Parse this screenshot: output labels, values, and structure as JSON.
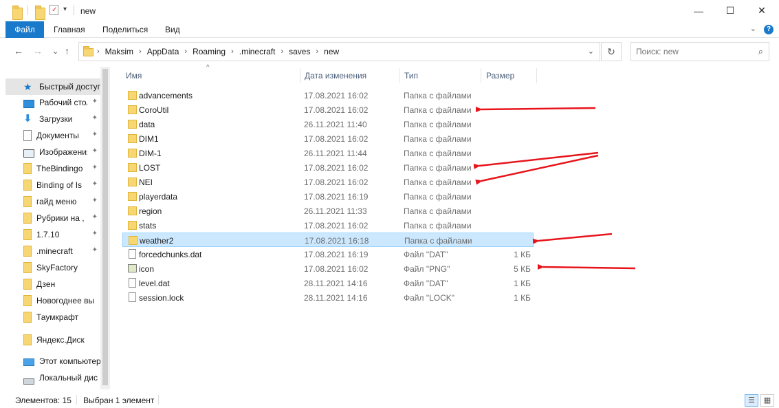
{
  "window": {
    "title": "new",
    "minimize_glyph": "—",
    "maximize_glyph": "☐",
    "close_glyph": "✕"
  },
  "ribbon": {
    "tabs": [
      "Файл",
      "Главная",
      "Поделиться",
      "Вид"
    ],
    "expand_glyph": "⌄",
    "help_glyph": "?"
  },
  "nav": {
    "back_glyph": "←",
    "forward_glyph": "→",
    "recent_glyph": "⌄",
    "up_glyph": "↑",
    "breadcrumbs": [
      "Maksim",
      "AppData",
      "Roaming",
      ".minecraft",
      "saves",
      "new"
    ],
    "crumb_sep": "›",
    "refresh_glyph": "↻",
    "search_placeholder": "Поиск: new",
    "search_icon_glyph": "⌕"
  },
  "sidebar": {
    "quick_access": "Быстрый доступ",
    "items": [
      {
        "label": "Рабочий стол",
        "icon": "desktop-icon",
        "pinned": true
      },
      {
        "label": "Загрузки",
        "icon": "download-icon",
        "pinned": true
      },
      {
        "label": "Документы",
        "icon": "document-icon",
        "pinned": true
      },
      {
        "label": "Изображения",
        "icon": "image-icon",
        "pinned": true
      },
      {
        "label": "TheBindingo",
        "icon": "folder-icon",
        "pinned": true
      },
      {
        "label": "Binding of Is",
        "icon": "folder-icon",
        "pinned": true
      },
      {
        "label": "гайд меню",
        "icon": "folder-icon",
        "pinned": true
      },
      {
        "label": "Рубрики на ,",
        "icon": "folder-icon",
        "pinned": true
      },
      {
        "label": "1.7.10",
        "icon": "folder-icon",
        "pinned": true
      },
      {
        "label": ".minecraft",
        "icon": "folder-icon",
        "pinned": true
      },
      {
        "label": "SkyFactory",
        "icon": "folder-icon",
        "pinned": false
      },
      {
        "label": "Дзен",
        "icon": "folder-icon",
        "pinned": false
      },
      {
        "label": "Новогоднее вы",
        "icon": "folder-icon",
        "pinned": false
      },
      {
        "label": "Таумкрафт",
        "icon": "folder-icon",
        "pinned": false
      }
    ],
    "yandex_disk": "Яндекс.Диск",
    "this_pc": "Этот компьютер",
    "local_disk": "Локальный дис",
    "pin_glyph": "📌"
  },
  "columns": {
    "name": "Имя",
    "date": "Дата изменения",
    "type": "Тип",
    "size": "Размер",
    "sort_glyph": "^"
  },
  "files": [
    {
      "name": "advancements",
      "date": "17.08.2021 16:02",
      "type": "Папка с файлами",
      "size": "",
      "kind": "folder"
    },
    {
      "name": "CoroUtil",
      "date": "17.08.2021 16:02",
      "type": "Папка с файлами",
      "size": "",
      "kind": "folder"
    },
    {
      "name": "data",
      "date": "26.11.2021 11:40",
      "type": "Папка с файлами",
      "size": "",
      "kind": "folder"
    },
    {
      "name": "DIM1",
      "date": "17.08.2021 16:02",
      "type": "Папка с файлами",
      "size": "",
      "kind": "folder"
    },
    {
      "name": "DIM-1",
      "date": "26.11.2021 11:44",
      "type": "Папка с файлами",
      "size": "",
      "kind": "folder"
    },
    {
      "name": "LOST",
      "date": "17.08.2021 16:02",
      "type": "Папка с файлами",
      "size": "",
      "kind": "folder"
    },
    {
      "name": "NEI",
      "date": "17.08.2021 16:02",
      "type": "Папка с файлами",
      "size": "",
      "kind": "folder"
    },
    {
      "name": "playerdata",
      "date": "17.08.2021 16:19",
      "type": "Папка с файлами",
      "size": "",
      "kind": "folder"
    },
    {
      "name": "region",
      "date": "26.11.2021 11:33",
      "type": "Папка с файлами",
      "size": "",
      "kind": "folder"
    },
    {
      "name": "stats",
      "date": "17.08.2021 16:02",
      "type": "Папка с файлами",
      "size": "",
      "kind": "folder"
    },
    {
      "name": "weather2",
      "date": "17.08.2021 16:18",
      "type": "Папка с файлами",
      "size": "",
      "kind": "folder",
      "selected": true
    },
    {
      "name": "forcedchunks.dat",
      "date": "17.08.2021 16:19",
      "type": "Файл \"DAT\"",
      "size": "1 КБ",
      "kind": "file"
    },
    {
      "name": "icon",
      "date": "17.08.2021 16:02",
      "type": "Файл \"PNG\"",
      "size": "5 КБ",
      "kind": "png"
    },
    {
      "name": "level.dat",
      "date": "28.11.2021 14:16",
      "type": "Файл \"DAT\"",
      "size": "1 КБ",
      "kind": "file"
    },
    {
      "name": "session.lock",
      "date": "28.11.2021 14:16",
      "type": "Файл \"LOCK\"",
      "size": "1 КБ",
      "kind": "file"
    }
  ],
  "status": {
    "count": "Элементов: 15",
    "selected": "Выбран 1 элемент"
  },
  "colors": {
    "accent": "#1979ca",
    "selection": "#cce8ff",
    "annotation_arrow": "#e8141c"
  }
}
